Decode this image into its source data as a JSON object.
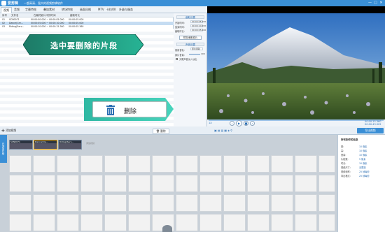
{
  "titlebar": {
    "app": "爱剪辑",
    "doc": "—超高清、强大的视频剪辑软件",
    "min": "—",
    "max": "□",
    "close": "✕"
  },
  "menu": [
    "视频",
    "音频",
    "字幕特效",
    "叠加素材",
    "转场特效",
    "画面风格",
    "MTV",
    "卡拉OK",
    "升级与服务"
  ],
  "table": {
    "headers": [
      "序号",
      "文件名",
      "在最终影片中的时间",
      "截取时长"
    ],
    "rows": [
      {
        "no": "01",
        "name": "SCN0071",
        "time": "00:00:00.000 ~ 00:00:05.000",
        "dur": "00:00:05.000",
        "sel": false
      },
      {
        "no": "02",
        "name": "Dance(Cre...",
        "time": "00:00:05.000 ~ 00:00:10.000",
        "dur": "00:00:05.000",
        "sel": true
      },
      {
        "no": "03",
        "name": "Riding(Serv...",
        "time": "00:00:10.000 ~ 00:00:15.360",
        "dur": "00:00:05.360",
        "sel": false
      }
    ]
  },
  "settings": {
    "title": "截取设置",
    "start_label": "开始时间:",
    "start": "00:00:05.000",
    "end_label": "结束时间:",
    "end": "00:00:10.000",
    "dur_label": "截取时长:",
    "dur": "00:00:05.000",
    "pick_btn": "预览/截取原片",
    "sound_title": "声音设置",
    "sound_label": "使用音轨:",
    "sound": "原片音轨",
    "vol_label": "原片音量:",
    "vol": "100",
    "head_label": "头尾声音淡入淡出",
    "confirm": "确认修改"
  },
  "callouts": {
    "select": "选中要删除的片段",
    "delete": "删除"
  },
  "toolbar": {
    "add_video": "添加视频",
    "delete": "删除",
    "export": "导出视频"
  },
  "player": {
    "time": "00:00:15.360",
    "total": "00:00:43.902",
    "speed": "1X"
  },
  "timeline": {
    "side": "已添加片段",
    "clips": [
      "SCN0071",
      "Dance(Cre...",
      "Riding(Serv..."
    ],
    "add_hint": "添加视频"
  },
  "props": {
    "title": "所有制作的信息",
    "rows": [
      [
        "宽:",
        "10 像素"
      ],
      [
        "高:",
        "10 像素"
      ],
      [
        "音量:",
        "10 像素"
      ],
      [
        "片段数:",
        "5 像素"
      ],
      [
        "时长:",
        "10 像素"
      ],
      [
        "视频尺寸:",
        "无限制"
      ],
      [
        "视频帧率:",
        "25 帧每秒"
      ],
      [
        "导出格式:",
        "25 帧每秒"
      ]
    ]
  }
}
